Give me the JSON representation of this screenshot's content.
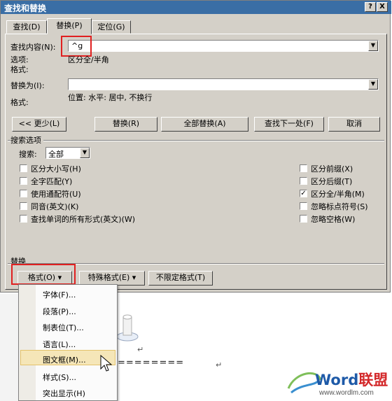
{
  "window": {
    "title": "查找和替换",
    "help_label": "?",
    "close_label": "X"
  },
  "tabs": [
    {
      "label": "查找(D)"
    },
    {
      "label": "替换(P)"
    },
    {
      "label": "定位(G)"
    }
  ],
  "find": {
    "label": "查找内容(N):",
    "value": "^g",
    "options_label": "选项:",
    "options_value": "区分全/半角",
    "format_label": "格式:"
  },
  "replace": {
    "label": "替换为(I):",
    "value": "",
    "format_label": "格式:",
    "format_value": "位置: 水平: 居中, 不换行"
  },
  "buttons": {
    "less": "<< 更少(L)",
    "replace": "替换(R)",
    "replace_all": "全部替换(A)",
    "find_next": "查找下一处(F)",
    "cancel": "取消"
  },
  "search_options": {
    "title": "搜索选项",
    "search_label": "搜索:",
    "search_value": "全部",
    "left_checks": [
      {
        "label": "区分大小写(H)",
        "checked": false
      },
      {
        "label": "全字匹配(Y)",
        "checked": false
      },
      {
        "label": "使用通配符(U)",
        "checked": false
      },
      {
        "label": "同音(英文)(K)",
        "checked": false
      },
      {
        "label": "查找单词的所有形式(英文)(W)",
        "checked": false
      }
    ],
    "right_checks": [
      {
        "label": "区分前缀(X)",
        "checked": false
      },
      {
        "label": "区分后缀(T)",
        "checked": false
      },
      {
        "label": "区分全/半角(M)",
        "checked": true
      },
      {
        "label": "忽略标点符号(S)",
        "checked": false
      },
      {
        "label": "忽略空格(W)",
        "checked": false
      }
    ]
  },
  "replace_section": {
    "title": "替换",
    "format_button": "格式(O) ▾",
    "special_button": "特殊格式(E) ▾",
    "no_format_button": "不限定格式(T)"
  },
  "format_menu": {
    "items": [
      "字体(F)...",
      "段落(P)...",
      "制表位(T)...",
      "语言(L)...",
      "图文框(M)...",
      "样式(S)...",
      "突出显示(H)"
    ],
    "highlighted": "图文框(M)..."
  },
  "document": {
    "equals_line": "========",
    "return_mark": "↵"
  },
  "watermark": {
    "brand_a": "Word",
    "brand_b": "联盟",
    "url": "www.wordlm.com"
  },
  "colors": {
    "title_bar": "#3a6ea5",
    "dialog_bg": "#d4d0c8",
    "highlight_red": "#e02020",
    "menu_highlight": "#f5e6b8"
  }
}
